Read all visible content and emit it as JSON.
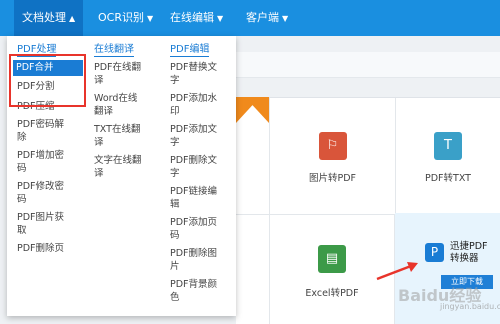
{
  "nav": {
    "items": [
      {
        "label": "文档处理",
        "arrow": "▲"
      },
      {
        "label": "OCR识别",
        "arrow": "▼"
      },
      {
        "label": "在线编辑",
        "arrow": "▼"
      },
      {
        "label": "客户端",
        "arrow": "▼"
      }
    ]
  },
  "dropdown": {
    "col1": {
      "heading": "PDF处理",
      "items": [
        "PDF合并",
        "PDF分割",
        "PDF压缩",
        "PDF密码解",
        "除",
        "PDF增加密",
        "码",
        "PDF修改密",
        "码",
        "PDF图片获",
        "取",
        "PDF删除页"
      ]
    },
    "col2": {
      "heading": "在线翻译",
      "items": [
        "PDF在线翻",
        "译",
        "Word在线",
        "翻译",
        "TXT在线翻",
        "译",
        "文字在线翻",
        "译"
      ]
    },
    "col3": {
      "heading": "PDF编辑",
      "items": [
        "PDF替换文",
        "字",
        "PDF添加水",
        "印",
        "PDF添加文",
        "字",
        "PDF删除文",
        "字",
        "PDF链接编",
        "辑",
        "PDF添加页",
        "码",
        "PDF删除图",
        "片",
        "PDF背景颜",
        "色"
      ]
    }
  },
  "tools": {
    "img2pdf": {
      "label": "图片转PDF",
      "icon": "pdf-icon"
    },
    "pdf2txt": {
      "label": "PDF转TXT",
      "icon": "T"
    },
    "excel2pdf": {
      "label": "Excel转PDF",
      "icon": "excel-icon"
    }
  },
  "promo": {
    "icon": "P",
    "title_line1": "迅捷PDF",
    "title_line2": "转换器",
    "download": "立即下载"
  },
  "watermark": {
    "text": "Baidu经验",
    "sub": "jingyan.baidu.com"
  },
  "colors": {
    "nav": "#1a8fe0",
    "accent": "#1a7cd4",
    "highlight_box": "#e8342b",
    "ribbon": "#f08a1c"
  }
}
